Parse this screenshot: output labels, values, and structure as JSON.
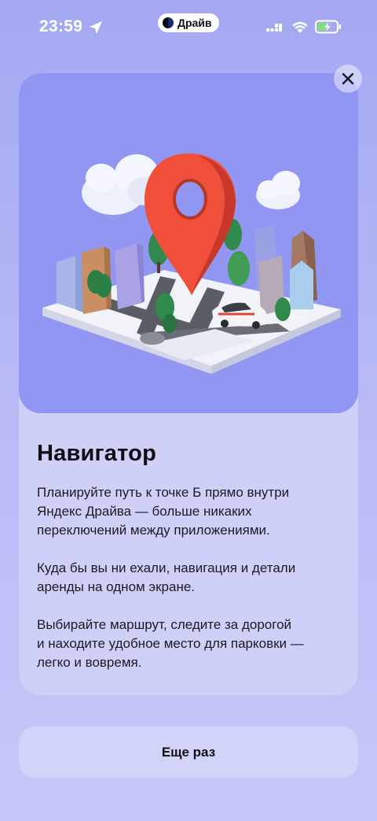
{
  "status_bar": {
    "time": "23:59",
    "app_pill_label": "Драйв",
    "icons": [
      "location-arrow-icon",
      "drive-app-icon",
      "cellular-signal-icon",
      "wifi-icon",
      "battery-charging-icon"
    ]
  },
  "close_button": {
    "icon": "close-icon"
  },
  "card": {
    "illustration": "navigator-city-map-illustration",
    "title": "Навигатор",
    "paragraphs": [
      [
        "Планируйте путь к точке Б прямо внутри",
        "Яндекс Драйва — больше никаких",
        "переключений между приложениями."
      ],
      [
        "Куда бы вы ни ехали, навигация и детали",
        "аренды на одном экране."
      ],
      [
        "Выбирайте маршрут, следите за дорогой",
        "и находите удобное место для парковки —",
        "легко и вовремя."
      ]
    ]
  },
  "retry_button": {
    "label": "Еще раз"
  },
  "colors": {
    "background": "#a3a8f2",
    "illustration_bg": "#9096f2",
    "card_bg": "#cfd0f7",
    "pin_red": "#f0503a",
    "battery_green": "#7ee07e"
  }
}
